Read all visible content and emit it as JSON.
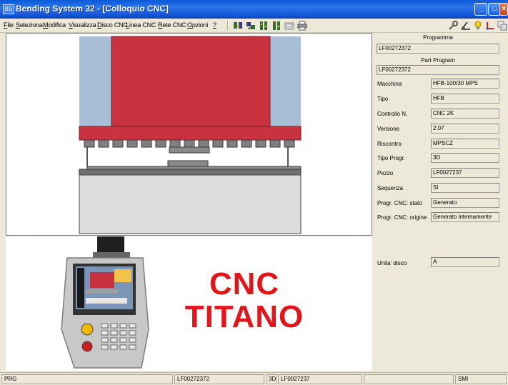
{
  "window": {
    "title": "Bending System 32 - [Colloquio CNC]",
    "app_icon_text": "BS",
    "minimize": "_",
    "maximize": "□",
    "close": "×"
  },
  "menu": [
    {
      "label": "File",
      "mnemonic": "F"
    },
    {
      "label": "Seleziona",
      "mnemonic": "S"
    },
    {
      "label": "Modifica",
      "mnemonic": "M"
    },
    {
      "label": "Visualizza",
      "mnemonic": "V"
    },
    {
      "label": "Disco CNC",
      "mnemonic": "D"
    },
    {
      "label": "Linea CNC",
      "mnemonic": "L"
    },
    {
      "label": "Rete CNC",
      "mnemonic": "R"
    },
    {
      "label": "Opzioni",
      "mnemonic": "O"
    },
    {
      "label": "?",
      "mnemonic": "?"
    }
  ],
  "toolbar_icons": [
    "send-to-cnc-icon",
    "receive-from-cnc-icon",
    "cnc-compare-icon",
    "cnc-status-icon",
    "disk-icon",
    "print-icon"
  ],
  "right_toolbar_icons": [
    "wrench-icon",
    "bend-angle-icon",
    "lightbulb-icon",
    "axis-icon",
    "window-copy-icon"
  ],
  "info": {
    "programma_label": "Programma",
    "programma_value": "LF00272372",
    "part_program_label": "Part Program",
    "part_program_value": "LF00272372",
    "rows": [
      {
        "label": "Macchina",
        "value": "HFB-100/30 MPS"
      },
      {
        "label": "Tipo",
        "value": "HFB"
      },
      {
        "label": "Controllo N.",
        "value": "CNC 2K"
      },
      {
        "label": "Versione",
        "value": " 2.07"
      },
      {
        "label": "Riscontro",
        "value": "MPSCZ"
      },
      {
        "label": "Tipo Progr.",
        "value": "3D"
      },
      {
        "label": "Pezzo",
        "value": "LF0027237"
      },
      {
        "label": "Sequenza",
        "value": "SI"
      },
      {
        "label": "Progr. CNC: stato",
        "value": "Generato"
      },
      {
        "label": "Progr. CNC: origine",
        "value": "Generato internamente"
      }
    ],
    "disk_label": "Unita' disco",
    "disk_value": "A"
  },
  "brand": {
    "line1": "CNC",
    "line2": "TITANO",
    "color": "#e0161a"
  },
  "colors": {
    "ram": "#c8323f",
    "ram_side": "#a8bed6",
    "bed": "#dcdcdc"
  },
  "status": {
    "mode": "PRG",
    "program": "LF00272372",
    "type": "3D",
    "part": "LF0027237",
    "unit": "SMI"
  }
}
